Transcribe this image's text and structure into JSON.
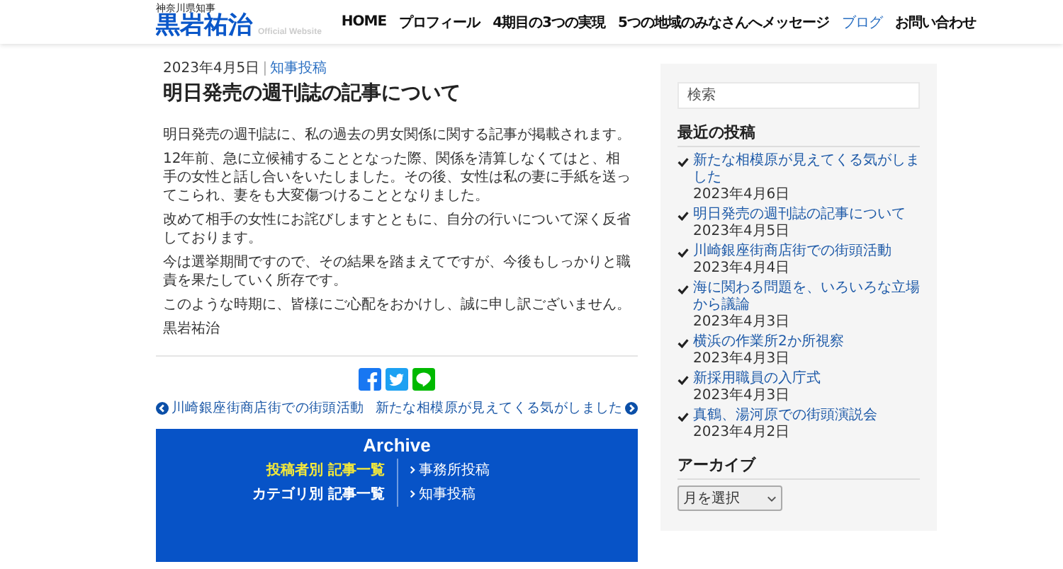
{
  "header": {
    "logo_caption": "神奈川県知事",
    "logo_name": "黒岩祐治",
    "logo_tagline": "Official Website",
    "nav": [
      {
        "label": "HOME",
        "selected": false
      },
      {
        "label": "プロフィール",
        "selected": false
      },
      {
        "label": "4期目の3つの実現",
        "selected": false
      },
      {
        "label": "5つの地域のみなさんへメッセージ",
        "selected": false
      },
      {
        "label": "ブログ",
        "selected": true
      },
      {
        "label": "お問い合わせ",
        "selected": false
      }
    ]
  },
  "article": {
    "date": "2023年4月5日",
    "separator": "|",
    "category": "知事投稿",
    "title": "明日発売の週刊誌の記事について",
    "paragraphs": [
      "明日発売の週刊誌に、私の過去の男女関係に関する記事が掲載されます。",
      "12年前、急に立候補することとなった際、関係を清算しなくてはと、相手の女性と話し合いをいたしました。その後、女性は私の妻に手紙を送ってこられ、妻をも大変傷つけることとなりました。",
      "改めて相手の女性にお詫びしますとともに、自分の行いについて深く反省しております。",
      "今は選挙期間ですので、その結果を踏まえてですが、今後もしっかりと職責を果たしていく所存です。",
      "このような時期に、皆様にご心配をおかけし、誠に申し訳ございません。",
      "黒岩祐治"
    ],
    "share": [
      {
        "kind": "facebook"
      },
      {
        "kind": "twitter"
      },
      {
        "kind": "line"
      }
    ],
    "prev_post": "川崎銀座街商店街での街頭活動",
    "next_post": "新たな相模原が見えてくる気がしました"
  },
  "sidebar": {
    "search": {
      "placeholder": "検索"
    },
    "recent_heading": "最近の投稿",
    "recent_posts": [
      {
        "title": "新たな相模原が見えてくる気がしました",
        "date": "2023年4月6日"
      },
      {
        "title": "明日発売の週刊誌の記事について",
        "date": "2023年4月5日"
      },
      {
        "title": "川崎銀座街商店街での街頭活動",
        "date": "2023年4月4日"
      },
      {
        "title": "海に関わる問題を、いろいろな立場から議論",
        "date": "2023年4月3日"
      },
      {
        "title": "横浜の作業所2か所視察",
        "date": "2023年4月3日"
      },
      {
        "title": "新採用職員の入庁式",
        "date": "2023年4月3日"
      },
      {
        "title": "真鶴、湯河原での街頭演説会",
        "date": "2023年4月2日"
      }
    ],
    "archive_heading": "アーカイブ",
    "archive_select": "月を選択"
  },
  "footer_archive": {
    "title": "Archive",
    "left": [
      {
        "label": "投稿者別 記事一覧",
        "selected": true
      },
      {
        "label": "カテゴリ別 記事一覧",
        "selected": false
      }
    ],
    "right": [
      "事務所投稿",
      "知事投稿"
    ]
  }
}
